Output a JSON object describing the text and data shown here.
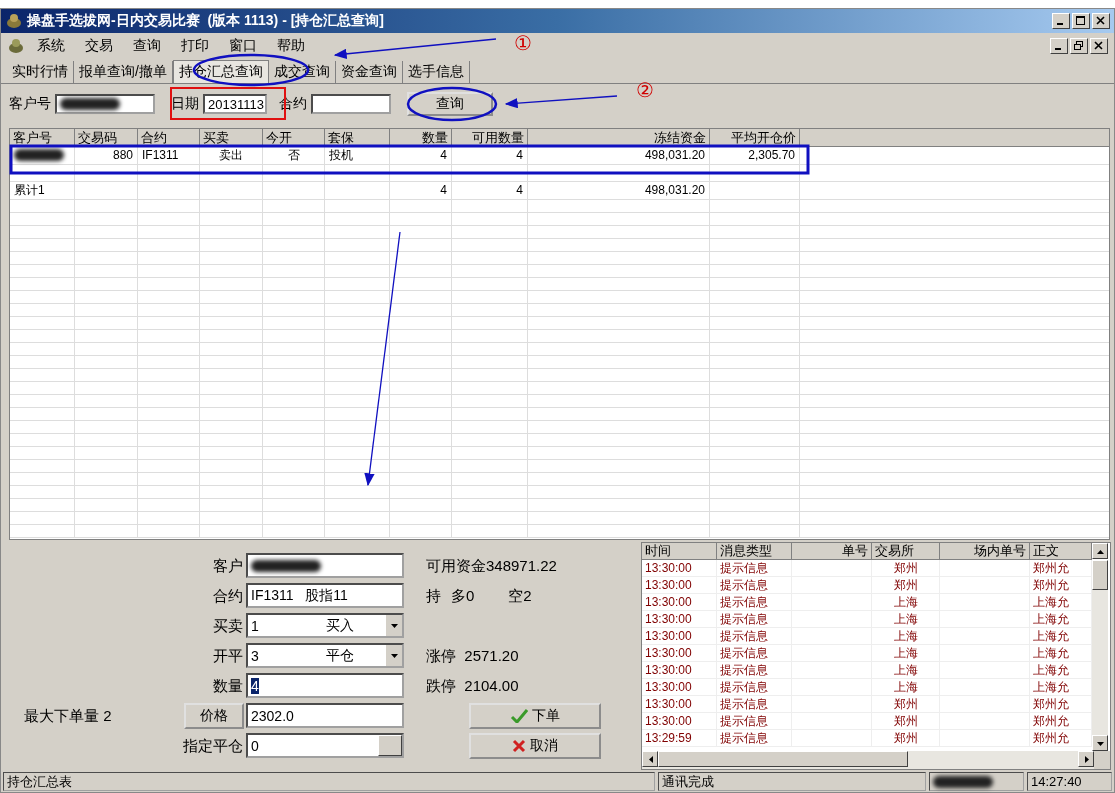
{
  "window": {
    "title": "操盘手选拔网-日内交易比赛  (版本 1113) - [持仓汇总查询]"
  },
  "menu": [
    "系统",
    "交易",
    "查询",
    "打印",
    "窗口",
    "帮助"
  ],
  "tabs": [
    {
      "label": "实时行情",
      "selected": false
    },
    {
      "label": "报单查询/撤单",
      "selected": false
    },
    {
      "label": "持仓汇总查询",
      "selected": true
    },
    {
      "label": "成交查询",
      "selected": false
    },
    {
      "label": "资金查询",
      "selected": false
    },
    {
      "label": "选手信息",
      "selected": false
    }
  ],
  "query": {
    "client_label": "客户号",
    "client_redacted": true,
    "date_label": "日期",
    "date_value": "20131113",
    "contract_label": "合约",
    "button": "查询"
  },
  "table": {
    "columns": [
      "客户号",
      "交易码",
      "合约",
      "买卖",
      "今开",
      "套保",
      "数量",
      "可用数量",
      "冻结资金",
      "平均开仓价"
    ],
    "rows": [
      {
        "redacted": true,
        "cells": [
          "",
          "880",
          "IF1311",
          "卖出",
          "否",
          "投机",
          "4",
          "4",
          "498,031.20",
          "2,305.70"
        ]
      },
      {
        "redacted": false,
        "cells": []
      },
      {
        "redacted": false,
        "cells": [
          "累计1",
          "",
          "",
          "",
          "",
          "",
          "4",
          "4",
          "498,031.20",
          ""
        ]
      }
    ]
  },
  "order": {
    "client_label": "客户",
    "client_redacted": true,
    "contract_label": "合约",
    "contract_value": "IF1311   股指11",
    "side_label": "买卖",
    "side_code": "1",
    "side_value": "买入",
    "offset_label": "开平",
    "offset_code": "3",
    "offset_value": "平仓",
    "qty_label": "数量",
    "qty_value": "4",
    "price_button": "价格",
    "price_value": "2302.0",
    "close_label": "指定平仓",
    "close_value": "0",
    "max_qty": "最大下单量 2"
  },
  "info": {
    "funds": "可用资金348971.22",
    "hold_label": "持",
    "long": "多0",
    "short": "空2",
    "limit_up": "涨停  2571.20",
    "limit_down": "跌停  2104.00",
    "submit": "下单",
    "cancel": "取消"
  },
  "messages": {
    "columns": [
      "时间",
      "消息类型",
      "单号",
      "交易所",
      "场内单号",
      "正文"
    ],
    "rows": [
      [
        "13:30:00",
        "提示信息",
        "",
        "郑州",
        "",
        "郑州允"
      ],
      [
        "13:30:00",
        "提示信息",
        "",
        "郑州",
        "",
        "郑州允"
      ],
      [
        "13:30:00",
        "提示信息",
        "",
        "上海",
        "",
        "上海允"
      ],
      [
        "13:30:00",
        "提示信息",
        "",
        "上海",
        "",
        "上海允"
      ],
      [
        "13:30:00",
        "提示信息",
        "",
        "上海",
        "",
        "上海允"
      ],
      [
        "13:30:00",
        "提示信息",
        "",
        "上海",
        "",
        "上海允"
      ],
      [
        "13:30:00",
        "提示信息",
        "",
        "上海",
        "",
        "上海允"
      ],
      [
        "13:30:00",
        "提示信息",
        "",
        "上海",
        "",
        "上海允"
      ],
      [
        "13:30:00",
        "提示信息",
        "",
        "郑州",
        "",
        "郑州允"
      ],
      [
        "13:30:00",
        "提示信息",
        "",
        "郑州",
        "",
        "郑州允"
      ],
      [
        "13:29:59",
        "提示信息",
        "",
        "郑州",
        "",
        "郑州允"
      ]
    ]
  },
  "status_bar": {
    "left": "持仓汇总表",
    "middle": "通讯完成",
    "redacted": true,
    "time": "14:27:40"
  },
  "annotations": [
    "①",
    "②"
  ]
}
